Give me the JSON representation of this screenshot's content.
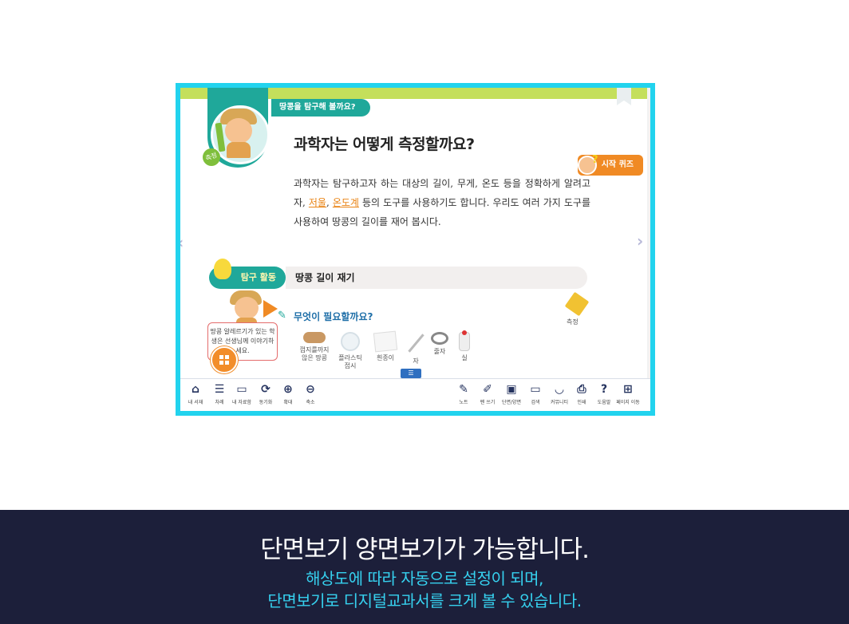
{
  "viewer": {
    "subject_tag": "땅콩을 탐구해 볼까요?",
    "side_tag": "측정",
    "lesson_title": "과학자는 어떻게 측정할까요?",
    "quiz_button": "시작 퀴즈",
    "body": {
      "part1": "과학자는 탐구하고자 하는 대상의 길이, 무게, 온도 등을 정확하게 알려고 자, ",
      "link1": "저울",
      "sep": ", ",
      "link2": "온도계",
      "part2": " 등의 도구를 사용하기도 합니다. 우리도 여러 가지 도구를 사용하여 땅콩의 길이를 재어 봅시다."
    },
    "activity_label": "탐구 활동",
    "activity_title": "땅콩 길이 재기",
    "balloon_text": "땅콩 알레르기가 있는 학생은 선생님께 이야기하세요.",
    "need_title": "무엇이 필요할까요?",
    "tools": [
      {
        "label": "껍지를까지 않은 땅콩"
      },
      {
        "label": "플라스틱 접시"
      },
      {
        "label": "흰종이"
      },
      {
        "label": "자"
      },
      {
        "label": "줄자"
      },
      {
        "label": "실"
      }
    ],
    "measure_label": "측정",
    "toolbar_left": [
      {
        "label": "내 서재",
        "icon": "book-icon"
      },
      {
        "label": "차례",
        "icon": "list-icon"
      },
      {
        "label": "내 자료함",
        "icon": "folder-icon"
      },
      {
        "label": "동기화",
        "icon": "sync-icon"
      },
      {
        "label": "확대",
        "icon": "zoom-in-icon"
      },
      {
        "label": "축소",
        "icon": "zoom-out-icon"
      }
    ],
    "toolbar_right": [
      {
        "label": "노트",
        "icon": "note-icon"
      },
      {
        "label": "펜 쓰기",
        "icon": "pen-icon"
      },
      {
        "label": "단면/양면",
        "icon": "monitor-icon"
      },
      {
        "label": "검색",
        "icon": "search-icon"
      },
      {
        "label": "커뮤니티",
        "icon": "community-icon"
      },
      {
        "label": "인쇄",
        "icon": "print-icon"
      },
      {
        "label": "도움말",
        "icon": "help-icon"
      },
      {
        "label": "페이지 이동",
        "icon": "grid-icon"
      }
    ]
  },
  "caption": {
    "title": "단면보기 양면보기가 가능합니다.",
    "line1": "해상도에 따라 자동으로 설정이 되며,",
    "line2": "단면보기로 디지털교과서를 크게 볼 수 있습니다."
  },
  "colors": {
    "frame": "#22d3ee",
    "teal": "#1fa89a",
    "topbar": "#c4df5b",
    "orange": "#f08a24",
    "caption_bg": "#1c1f3a",
    "caption_sub": "#36d1ef"
  }
}
